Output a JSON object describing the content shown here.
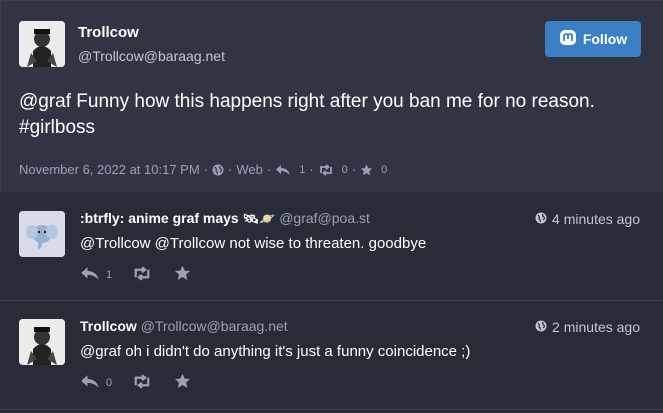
{
  "status": {
    "author": {
      "display_name": "Trollcow",
      "handle": "@Trollcow@baraag.net"
    },
    "follow_label": "Follow",
    "text": "@graf Funny how this happens right after you ban me for no reason. #girlboss",
    "date": "November 6, 2022 at 10:17 PM",
    "dot1": "·",
    "visibility": "Web",
    "dot2": "·",
    "reply_count": "1",
    "dot3": "·",
    "boost_count": "0",
    "dot4": "·",
    "fav_count": "0"
  },
  "replies": [
    {
      "display_name": ":btrfly: anime graf mays",
      "emoji": "🛰🪐",
      "handle": "@graf@poa.st",
      "time": "4 minutes ago",
      "text": "@Trollcow @Trollcow not wise to threaten. goodbye",
      "reply_count": "1"
    },
    {
      "display_name": "Trollcow",
      "handle": "@Trollcow@baraag.net",
      "time": "2 minutes ago",
      "text": "@graf oh i didn't do anything it's just a funny coincidence ;)",
      "reply_count": "0"
    }
  ],
  "colors": {
    "accent": "#3b7fc4",
    "card_bg": "#313543",
    "page_bg": "#282c37",
    "muted": "#9ba1b3"
  },
  "icons": [
    "globe-icon",
    "reply-icon",
    "boost-icon",
    "star-icon",
    "mastodon-icon"
  ]
}
